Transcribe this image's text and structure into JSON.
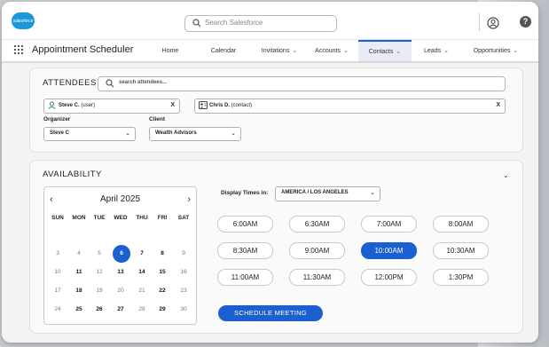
{
  "brand": {
    "logo_text": "salesforce",
    "accent": "#1b5fd0",
    "cloud_color": "#1b96d8"
  },
  "header": {
    "search_placeholder": "Search Salesforce",
    "user_icon": "user-icon",
    "help_icon": "help-icon",
    "help_glyph": "?"
  },
  "nav": {
    "app_name": "Appointment Scheduler",
    "items": [
      {
        "label": "Home",
        "chevron": ""
      },
      {
        "label": "Calendar",
        "chevron": ""
      },
      {
        "label": "Invitations",
        "chevron": "⌄"
      },
      {
        "label": "Accounts",
        "chevron": "⌄"
      },
      {
        "label": "Contacts",
        "chevron": "⌄"
      },
      {
        "label": "Leads",
        "chevron": "⌄"
      },
      {
        "label": "Opportunities",
        "chevron": "⌄"
      }
    ],
    "active": "Contacts"
  },
  "attendees": {
    "title": "ATTENDEES",
    "search_placeholder": "search attendees...",
    "selected": [
      {
        "name": "Steve C.",
        "role": " (user)",
        "remove": "X"
      },
      {
        "name": "Chris D.",
        "role": " (contact)",
        "remove": "X"
      }
    ],
    "organizer_label": "Organizer",
    "organizer_value": "Steve C",
    "client_label": "Client",
    "client_value": "Wealth Advisors"
  },
  "availability": {
    "title": "AVAILABILITY",
    "collapse_icon": "⌄",
    "calendar": {
      "month": "April 2025",
      "prev": "‹",
      "next": "›",
      "weekdays": [
        "SUN",
        "MON",
        "TUE",
        "WED",
        "THU",
        "FRI",
        "SAT"
      ],
      "weeks": [
        [
          "3",
          "4",
          "5",
          "6",
          "7",
          "8",
          "9"
        ],
        [
          "10",
          "11",
          "12",
          "13",
          "14",
          "15",
          "16"
        ],
        [
          "17",
          "18",
          "19",
          "20",
          "21",
          "22",
          "23"
        ],
        [
          "24",
          "25",
          "26",
          "27",
          "28",
          "29",
          "30"
        ]
      ],
      "selected_day": "6"
    },
    "display_label": "Display Times in:",
    "timezone": "AMERICA / LOS ANGELES",
    "slots": [
      "6:00AM",
      "6:30AM",
      "7:00AM",
      "8:00AM",
      "8:30AM",
      "9:00AM",
      "10:00AM",
      "10:30AM",
      "11:00AM",
      "11:30AM",
      "12:00PM",
      "1:30PM"
    ],
    "selected_slot": "10:00AM",
    "schedule_button": "SCHEDULE MEETING"
  }
}
